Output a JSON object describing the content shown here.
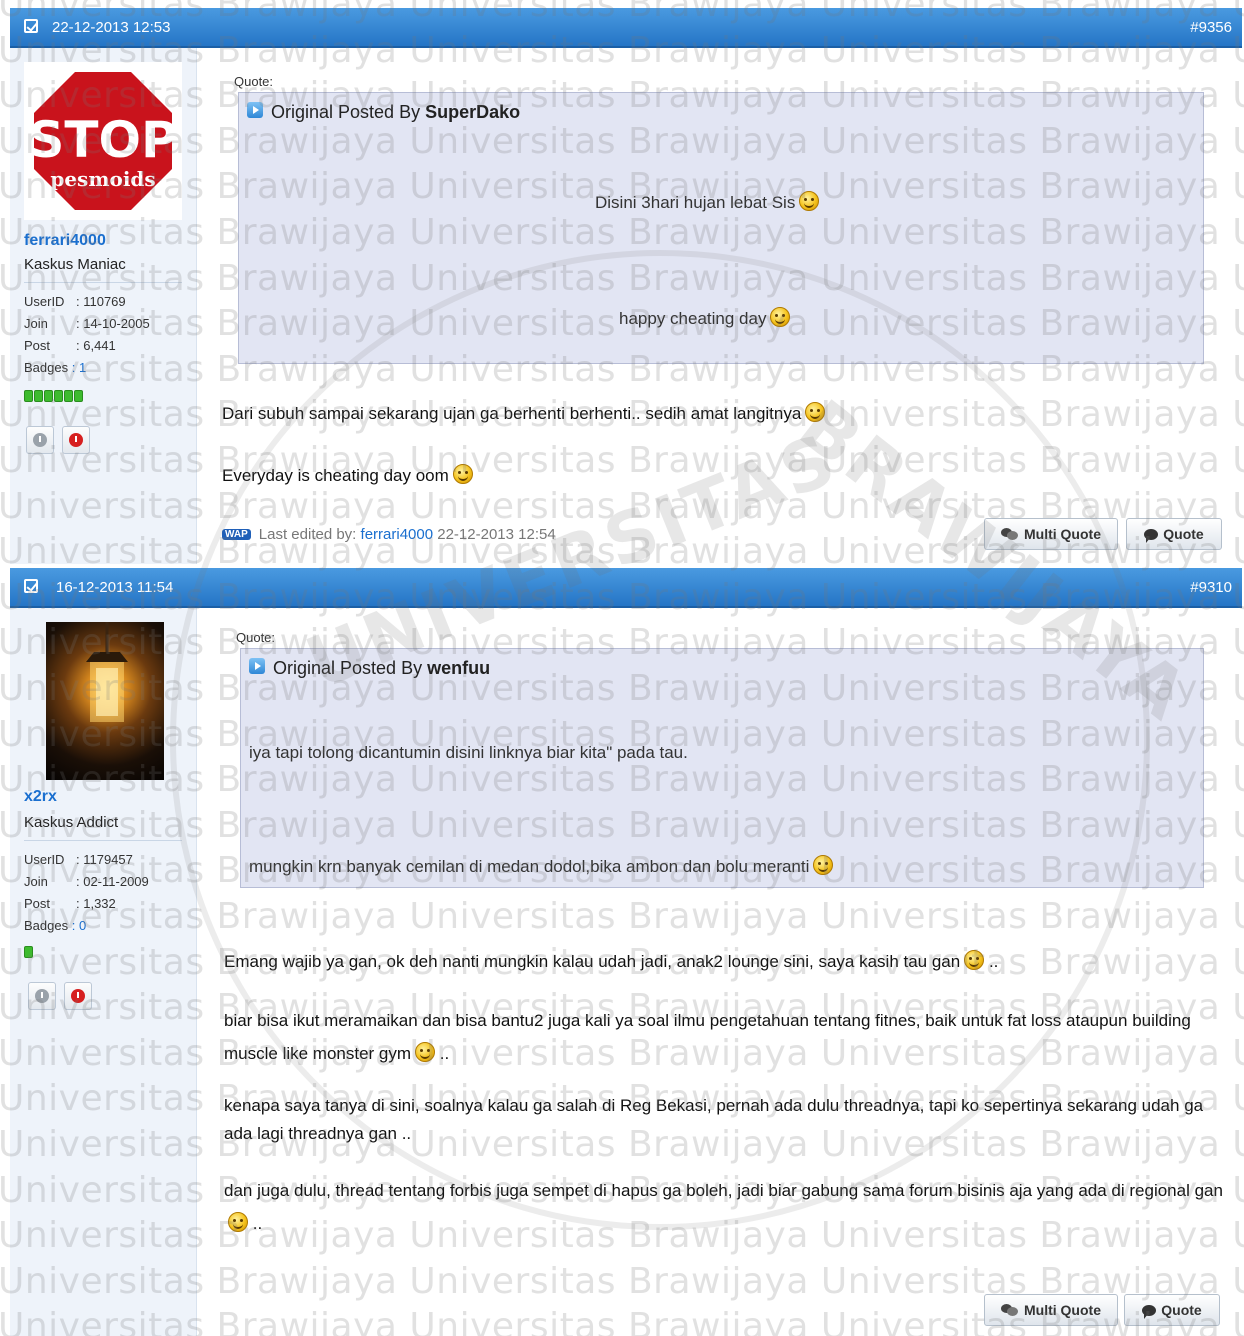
{
  "posts": [
    {
      "date": "22-12-2013 12:53",
      "number": "#9356",
      "user": {
        "name": "ferrari4000",
        "title": "Kaskus Maniac",
        "userid_label": "UserID",
        "userid": ": 110769",
        "join_label": "Join",
        "join": ": 14-10-2005",
        "post_label": "Post",
        "posts": ": 6,441",
        "badges_label": "Badges",
        "badges": ": 1",
        "avatar_text_top": "STOP",
        "avatar_text_bottom": "pesmoids"
      },
      "quote": {
        "label": "Quote:",
        "prefix": "Original Posted By",
        "author": "SuperDako",
        "lines": [
          "Disini 3hari hujan lebat Sis",
          "happy cheating day"
        ]
      },
      "message": [
        "Dari subuh sampai sekarang ujan ga berhenti berhenti.. sedih amat langitnya",
        "Everyday is cheating day oom"
      ],
      "edit": {
        "wap": "WAP",
        "text": "Last edited by:",
        "user": "ferrari4000",
        "date": "22-12-2013 12:54"
      },
      "buttons": {
        "multi_quote": "Multi Quote",
        "quote": "Quote"
      }
    },
    {
      "date": "16-12-2013 11:54",
      "number": "#9310",
      "user": {
        "name": "x2rx",
        "title": "Kaskus Addict",
        "userid_label": "UserID",
        "userid": ": 1179457",
        "join_label": "Join",
        "join": ": 02-11-2009",
        "post_label": "Post",
        "posts": ": 1,332",
        "badges_label": "Badges",
        "badges": ": 0"
      },
      "quote": {
        "label": "Quote:",
        "prefix": "Original Posted By",
        "author": "wenfuu",
        "lines": [
          "iya tapi tolong dicantumin disini linknya biar kita\" pada tau.",
          "mungkin krn banyak cemilan di medan dodol,bika ambon dan bolu meranti"
        ]
      },
      "message": [
        "Emang wajib ya gan, ok deh nanti mungkin kalau udah jadi, anak2 lounge sini, saya kasih tau gan",
        "..",
        "biar bisa ikut meramaikan dan bisa bantu2 juga kali ya soal ilmu pengetahuan tentang fitnes, baik untuk fat loss ataupun building muscle like monster gym",
        "..",
        "kenapa saya tanya di sini, soalnya kalau ga salah di Reg Bekasi, pernah ada dulu threadnya, tapi ko sepertinya sekarang udah ga ada lagi threadnya gan ..",
        "dan juga dulu, thread tentang forbis juga sempet di hapus ga boleh, jadi biar gabung sama forum bisinis aja yang ada di regional gan",
        ".."
      ],
      "buttons": {
        "multi_quote": "Multi Quote",
        "quote": "Quote"
      }
    }
  ],
  "watermark": {
    "text": "Universitas Brawijaya",
    "seal_left": "UNIVERSITAS",
    "seal_right": "BRAWIJAYA"
  }
}
